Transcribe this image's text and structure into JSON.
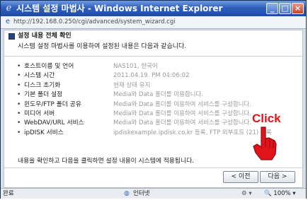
{
  "window": {
    "title": "시스템 설정 마법사 - Windows Internet Explorer",
    "address": "http://192.168.0.250/cgi/advanced/system_wizard.cgi"
  },
  "header": {
    "title": "설정 내용 전체 확인",
    "description": "시스템 설정 마법사를 이용하여 설정된 내용은 다음과 같습니다."
  },
  "summary": [
    {
      "label": "호스트이름 및 언어",
      "value": "NAS101, 한국어"
    },
    {
      "label": "시스템 시간",
      "value": "2011.04.19. PM 04:06:02"
    },
    {
      "label": "디스크 초기화",
      "value": "현재 상태 유지"
    },
    {
      "label": "기본 폴더 설정",
      "value": "Media와 Data 폴더를 이용합니다."
    },
    {
      "label": "윈도우/FTP 폴더 공유",
      "value": "Media와 Data 폴더를 이용하여 서비스를 구성합니다."
    },
    {
      "label": "미디어 서버",
      "value": "Media와 Data 폴더를 이용하여 서비스를 구성합니다."
    },
    {
      "label": "WebDAV/URL 서비스",
      "value": "Media와 Data 폴더를 이용하여 서비스를 구성합니다."
    },
    {
      "label": "ipDISK 서비스",
      "value": "ipdiskexample.ipdisk.co.kr 등록, FTP 외부포트 (21) 등록"
    }
  ],
  "footer_text": "내용을 확인하고 다음을 클릭하면 설정 내용이 시스템에 적용됩니다.",
  "buttons": {
    "prev": "< 이전",
    "next": "다음 >"
  },
  "annotation": {
    "click": "Click"
  },
  "statusbar": {
    "left": "완료",
    "zone": "인터넷",
    "zoom": "100%"
  }
}
